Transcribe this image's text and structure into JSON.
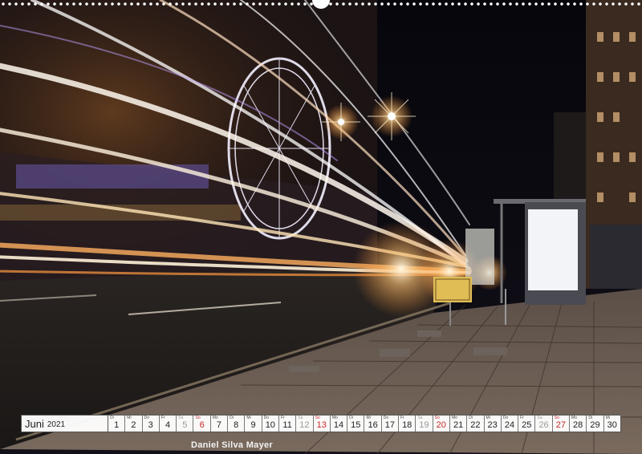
{
  "calendar": {
    "month": "Juni",
    "year": "2021",
    "days": [
      {
        "wd": "Di",
        "num": "1",
        "type": "weekday"
      },
      {
        "wd": "Mi",
        "num": "2",
        "type": "weekday"
      },
      {
        "wd": "Do",
        "num": "3",
        "type": "weekday"
      },
      {
        "wd": "Fr",
        "num": "4",
        "type": "weekday"
      },
      {
        "wd": "Sa",
        "num": "5",
        "type": "sat"
      },
      {
        "wd": "So",
        "num": "6",
        "type": "sun"
      },
      {
        "wd": "Mo",
        "num": "7",
        "type": "weekday"
      },
      {
        "wd": "Di",
        "num": "8",
        "type": "weekday"
      },
      {
        "wd": "Mi",
        "num": "9",
        "type": "weekday"
      },
      {
        "wd": "Do",
        "num": "10",
        "type": "weekday"
      },
      {
        "wd": "Fr",
        "num": "11",
        "type": "weekday"
      },
      {
        "wd": "Sa",
        "num": "12",
        "type": "sat"
      },
      {
        "wd": "So",
        "num": "13",
        "type": "sun"
      },
      {
        "wd": "Mo",
        "num": "14",
        "type": "weekday"
      },
      {
        "wd": "Di",
        "num": "15",
        "type": "weekday"
      },
      {
        "wd": "Mi",
        "num": "16",
        "type": "weekday"
      },
      {
        "wd": "Do",
        "num": "17",
        "type": "weekday"
      },
      {
        "wd": "Fr",
        "num": "18",
        "type": "weekday"
      },
      {
        "wd": "Sa",
        "num": "19",
        "type": "sat"
      },
      {
        "wd": "So",
        "num": "20",
        "type": "sun"
      },
      {
        "wd": "Mo",
        "num": "21",
        "type": "weekday"
      },
      {
        "wd": "Di",
        "num": "22",
        "type": "weekday"
      },
      {
        "wd": "Mi",
        "num": "23",
        "type": "weekday"
      },
      {
        "wd": "Do",
        "num": "24",
        "type": "weekday"
      },
      {
        "wd": "Fr",
        "num": "25",
        "type": "weekday"
      },
      {
        "wd": "Sa",
        "num": "26",
        "type": "sat"
      },
      {
        "wd": "So",
        "num": "27",
        "type": "sun"
      },
      {
        "wd": "Mo",
        "num": "28",
        "type": "weekday"
      },
      {
        "wd": "Di",
        "num": "29",
        "type": "weekday"
      },
      {
        "wd": "Mi",
        "num": "30",
        "type": "weekday"
      }
    ]
  },
  "photographer": "Daniel Silva Mayer",
  "colors": {
    "sunday": "#c42a2a",
    "saturday": "#9a9a9a",
    "light_trail": "#ffe8c2",
    "night_sky": "#07070d"
  }
}
